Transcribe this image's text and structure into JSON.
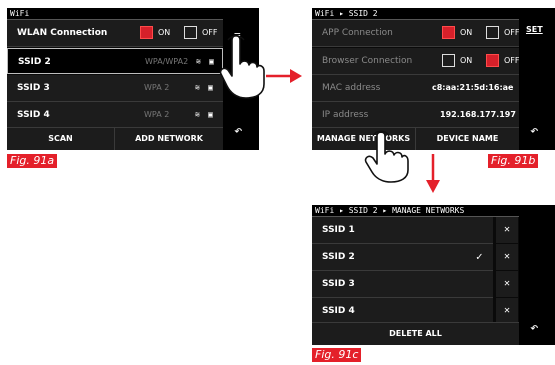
{
  "fig_a": {
    "header": "WiFi",
    "wlan": {
      "label": "WLAN Connection",
      "on": "ON",
      "off": "OFF"
    },
    "networks": [
      {
        "name": "SSID 2",
        "sec": "WPA/WPA2"
      },
      {
        "name": "SSID 3",
        "sec": "WPA 2"
      },
      {
        "name": "SSID 4",
        "sec": "WPA 2"
      }
    ],
    "scan": "SCAN",
    "add": "ADD NETWORK",
    "caption": "Fig. 91a"
  },
  "fig_b": {
    "header": "WiFi ▸ SSID 2",
    "app": {
      "label": "APP Connection",
      "on": "ON",
      "off": "OFF"
    },
    "browser": {
      "label": "Browser Connection",
      "on": "ON",
      "off": "OFF"
    },
    "mac": {
      "label": "MAC address",
      "value": "c8:aa:21:5d:16:ae"
    },
    "ip": {
      "label": "IP address",
      "value": "192.168.177.197"
    },
    "manage": "MANAGE NETWORKS",
    "device": "DEVICE NAME",
    "set": "SET",
    "caption": "Fig. 91b"
  },
  "fig_c": {
    "header": "WiFi ▸ SSID 2 ▸ MANAGE NETWORKS",
    "networks": [
      "SSID 1",
      "SSID 2",
      "SSID 3",
      "SSID 4"
    ],
    "delete_all": "DELETE ALL",
    "caption": "Fig. 91c"
  },
  "colors": {
    "accent": "#d6202a",
    "screen": "#0a0a0a",
    "row": "#1c1c1c"
  },
  "icons": [
    "wifi-signal-icon",
    "lock-icon",
    "back-icon",
    "check-icon",
    "delete-x-icon",
    "hand-pointer-icon",
    "arrow-icon"
  ]
}
